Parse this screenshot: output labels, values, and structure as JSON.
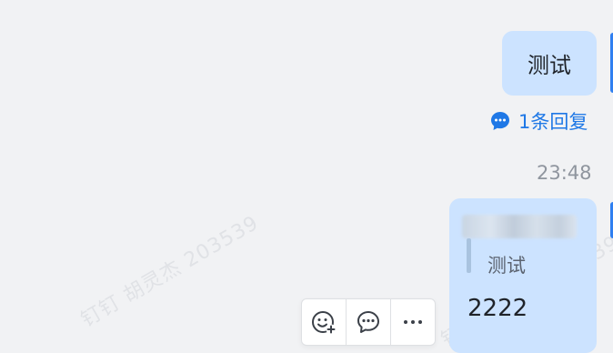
{
  "messages": [
    {
      "text": "测试"
    },
    {
      "quote_text": "测试",
      "text": "2222"
    }
  ],
  "thread": {
    "reply_count_label": "1条回复"
  },
  "timestamp": "23:48",
  "watermark": {
    "text": "钉钉 胡灵杰 203539"
  },
  "toolbar": {
    "buttons": [
      {
        "icon": "add-reaction-icon"
      },
      {
        "icon": "reply-icon"
      },
      {
        "icon": "more-icon"
      }
    ]
  },
  "colors": {
    "bubble": "#cce3ff",
    "link": "#1f78e6",
    "background": "#f1f2f4"
  }
}
